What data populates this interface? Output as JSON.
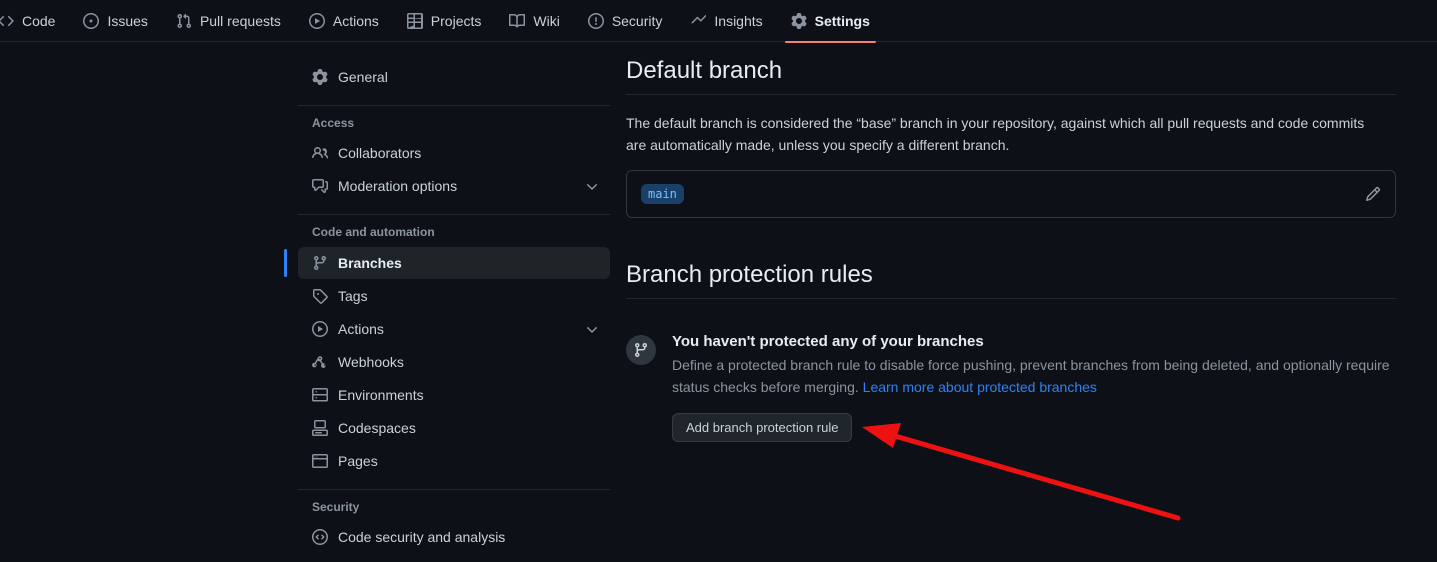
{
  "repo_nav": {
    "items": [
      {
        "label": "Code",
        "icon": "code-icon",
        "active": false
      },
      {
        "label": "Issues",
        "icon": "issue-opened-icon",
        "active": false
      },
      {
        "label": "Pull requests",
        "icon": "git-pull-request-icon",
        "active": false
      },
      {
        "label": "Actions",
        "icon": "play-icon",
        "active": false
      },
      {
        "label": "Projects",
        "icon": "table-icon",
        "active": false
      },
      {
        "label": "Wiki",
        "icon": "book-icon",
        "active": false
      },
      {
        "label": "Security",
        "icon": "shield-icon",
        "active": false
      },
      {
        "label": "Insights",
        "icon": "graph-icon",
        "active": false
      },
      {
        "label": "Settings",
        "icon": "gear-icon",
        "active": true
      }
    ],
    "active_tab": "Settings",
    "active_underline_color": "#f78166"
  },
  "sidebar": {
    "top_items": [
      {
        "label": "General",
        "icon": "gear-icon"
      }
    ],
    "groups": [
      {
        "title": "Access",
        "items": [
          {
            "label": "Collaborators",
            "icon": "people-icon",
            "expandable": false,
            "selected": false
          },
          {
            "label": "Moderation options",
            "icon": "comment-discussion-icon",
            "expandable": true,
            "selected": false
          }
        ]
      },
      {
        "title": "Code and automation",
        "items": [
          {
            "label": "Branches",
            "icon": "git-branch-icon",
            "expandable": false,
            "selected": true
          },
          {
            "label": "Tags",
            "icon": "tag-icon",
            "expandable": false,
            "selected": false
          },
          {
            "label": "Actions",
            "icon": "play-icon",
            "expandable": true,
            "selected": false
          },
          {
            "label": "Webhooks",
            "icon": "webhook-icon",
            "expandable": false,
            "selected": false
          },
          {
            "label": "Environments",
            "icon": "server-icon",
            "expandable": false,
            "selected": false
          },
          {
            "label": "Codespaces",
            "icon": "codespaces-icon",
            "expandable": false,
            "selected": false
          },
          {
            "label": "Pages",
            "icon": "browser-icon",
            "expandable": false,
            "selected": false
          }
        ]
      },
      {
        "title": "Security",
        "items": [
          {
            "label": "Code security and analysis",
            "icon": "codescan-icon",
            "expandable": false,
            "selected": false
          }
        ]
      }
    ],
    "selected_item": "Branches",
    "selected_accent_color": "#2f81f7"
  },
  "main": {
    "default_branch": {
      "title": "Default branch",
      "description": "The default branch is considered the “base” branch in your repository, against which all pull requests and code commits are automatically made, unless you specify a different branch.",
      "branch_name": "main",
      "edit_icon": "pencil-icon"
    },
    "branch_protection": {
      "title": "Branch protection rules",
      "badge_icon": "git-branch-icon",
      "empty_title": "You haven't protected any of your branches",
      "empty_text": "Define a protected branch rule to disable force pushing, prevent branches from being deleted, and optionally require status checks before merging.",
      "link_label": "Learn more about protected branches",
      "add_button_label": "Add branch protection rule"
    }
  },
  "annotation": {
    "type": "arrow",
    "color": "#ee1111",
    "points_to": "Add branch protection rule"
  }
}
